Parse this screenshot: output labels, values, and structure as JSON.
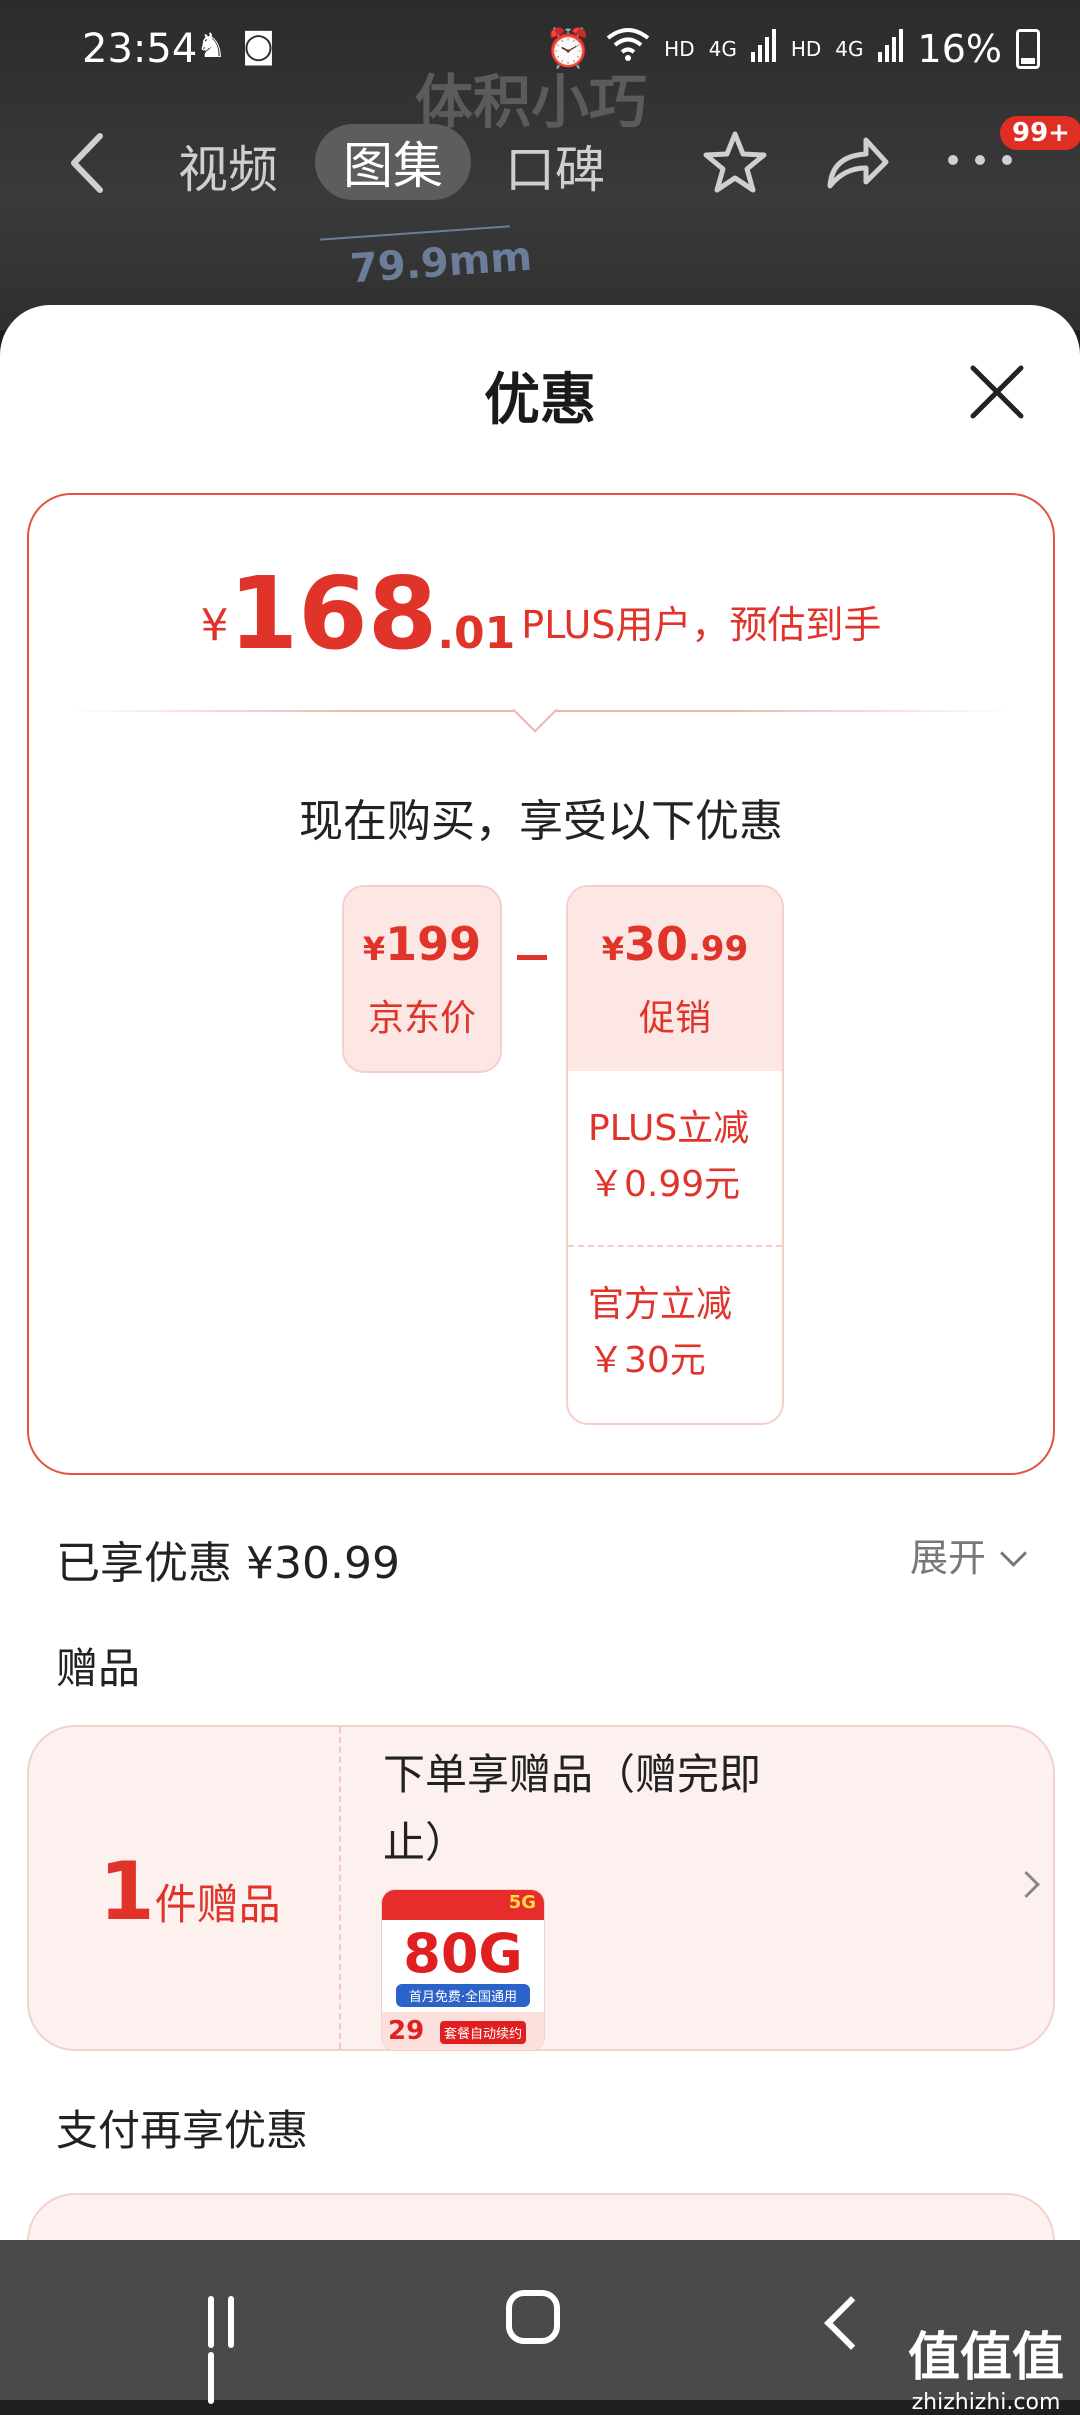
{
  "status_bar": {
    "time": "23:54",
    "hd1": "HD",
    "net1": "4G",
    "hd2": "HD",
    "net2": "4G",
    "battery": "16%"
  },
  "background": {
    "title": "体积小巧",
    "dimension": "79.9mm"
  },
  "top_nav": {
    "tabs": [
      {
        "label": "视频",
        "active": false
      },
      {
        "label": "图集",
        "active": true
      },
      {
        "label": "口碑",
        "active": false
      }
    ],
    "badge": "99+"
  },
  "sheet": {
    "title": "优惠",
    "price": {
      "currency": "¥",
      "integer": "168",
      "decimal": ".01",
      "note": "PLUS用户，预估到手"
    },
    "buy_now_text": "现在购买，享受以下优惠",
    "jd_price": {
      "currency": "¥",
      "amount": "199",
      "label": "京东价"
    },
    "promotion": {
      "currency": "¥",
      "integer": "30",
      "decimal": ".99",
      "label": "促销",
      "items": [
        {
          "name": "PLUS立减",
          "amount": "￥0.99元"
        },
        {
          "name": "官方立减",
          "amount": "￥30元"
        }
      ]
    },
    "enjoyed": "已享优惠 ¥30.99",
    "expand_label": "展开",
    "gift_section_title": "赠品",
    "gift": {
      "count": "1",
      "unit": "件赠品",
      "description": "下单享赠品（赠完即止）",
      "image": {
        "data_label": "80G",
        "price": "29",
        "tag": "套餐自动续约",
        "band": "首月免费·全国通用",
        "net": "5G"
      }
    },
    "pay_section_title": "支付再享优惠"
  },
  "watermark": {
    "text": "值值值",
    "sub": "zhizhizhi.com"
  }
}
